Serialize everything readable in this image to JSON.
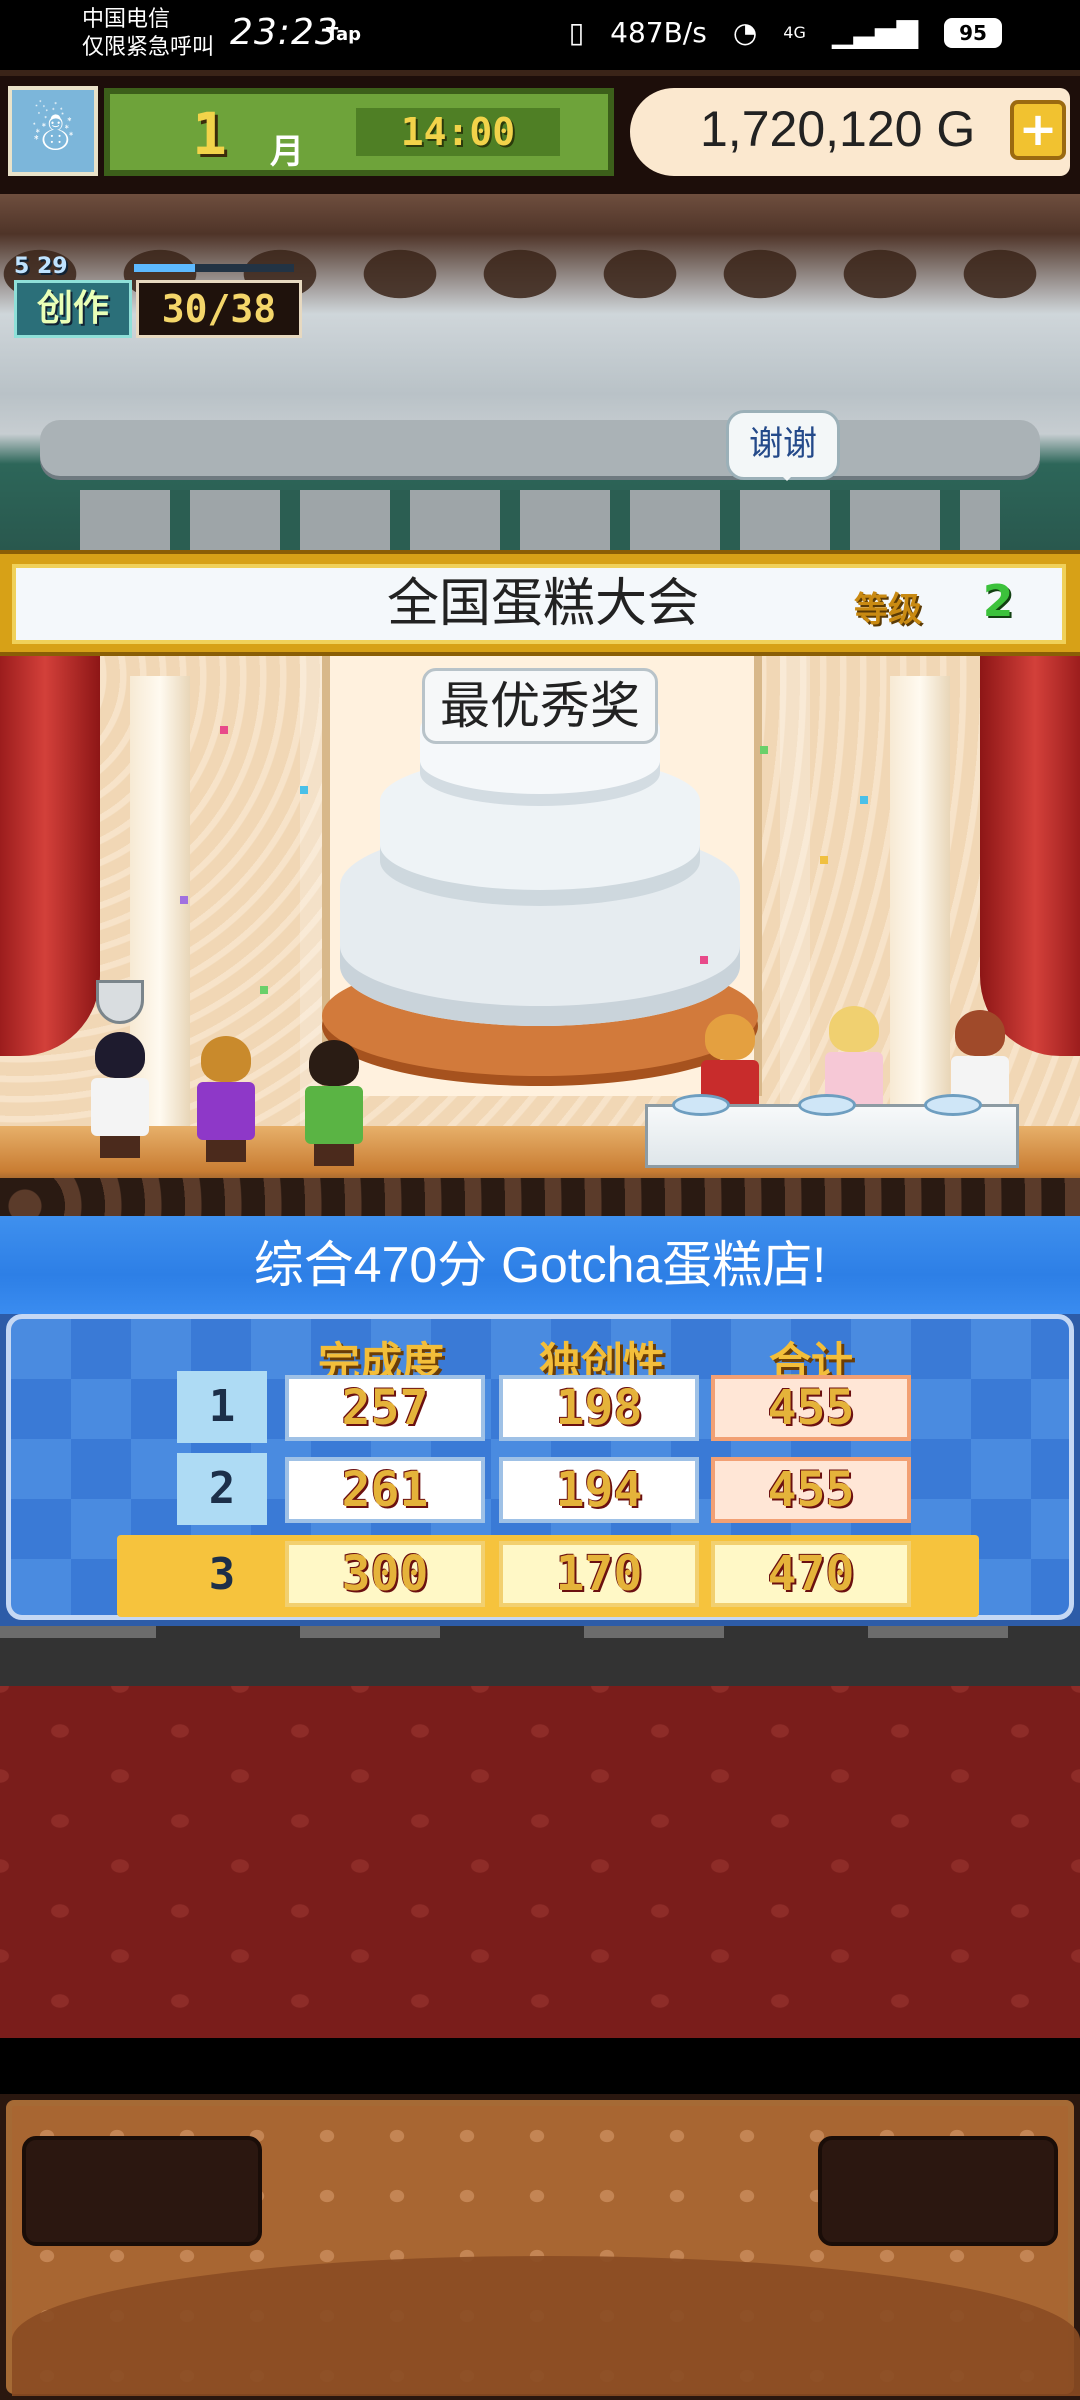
{
  "status_bar": {
    "carrier_line1": "中国电信",
    "carrier_line2": "仅限紧急呼叫",
    "time": "23:23",
    "tap_label": "Tap",
    "vibrate_icon": "vibrate-icon",
    "net_speed": "487B/s",
    "wifi_icon": "wifi-icon",
    "signal_label": "4G",
    "battery": "95"
  },
  "hud": {
    "avatar_icon": "snowman-icon",
    "month": "1",
    "month_label": "月",
    "time": "14:00",
    "money": "1,720,120",
    "currency": "G",
    "add_money_label": "+",
    "progress_small": "5 29",
    "progress_fill": 0.38,
    "creation_label": "创作",
    "creation_value": "30/38",
    "thanks_bubble": "谢谢"
  },
  "contest": {
    "title": "全国蛋糕大会",
    "level_label": "等级",
    "level_value": "2"
  },
  "scene": {
    "award_title": "最优秀奖"
  },
  "results": {
    "headline": "综合470分 Gotcha蛋糕店!",
    "columns": [
      "完成度",
      "独创性",
      "合计"
    ],
    "rows": [
      {
        "rank": "1",
        "completion": "257",
        "originality": "198",
        "total": "455"
      },
      {
        "rank": "2",
        "completion": "261",
        "originality": "194",
        "total": "455"
      },
      {
        "rank": "3",
        "completion": "300",
        "originality": "170",
        "total": "470"
      }
    ]
  },
  "colors": {
    "results_blue": "#2d7fe6",
    "winner_highlight": "#f6c33d",
    "score_text": "#e5b33a"
  }
}
